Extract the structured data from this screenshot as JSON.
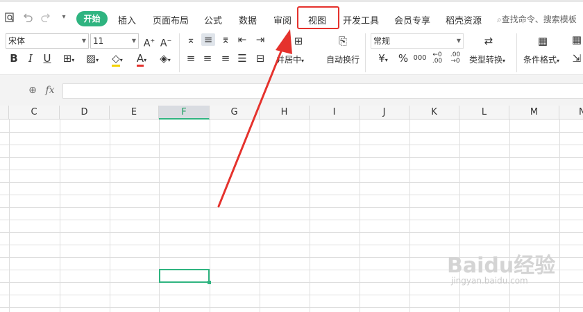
{
  "menubar": {
    "start_label": "开始",
    "tabs": [
      "插入",
      "页面布局",
      "公式",
      "数据",
      "审阅",
      "视图",
      "开发工具",
      "会员专享",
      "稻壳资源"
    ],
    "search_placeholder": "查找命令、搜索模板"
  },
  "toolbar": {
    "font_name": "宋体",
    "font_size": "11",
    "merge_label": "并居中",
    "wrap_label": "自动换行",
    "number_format": "常规",
    "currency_symbol": "¥",
    "percent_symbol": "%",
    "thousands_symbol": "000",
    "type_convert_label": "类型转换",
    "cond_format_label": "条件格式"
  },
  "formula_bar": {
    "fx_label": "fx"
  },
  "sheet": {
    "columns": [
      "C",
      "D",
      "E",
      "F",
      "G",
      "H",
      "I",
      "J",
      "K",
      "L",
      "M",
      "N"
    ],
    "selected_column": "F"
  },
  "annotation": {
    "highlight_color": "#e5322d"
  },
  "watermark": {
    "main": "Baidu经验",
    "sub": "jingyan.baidu.com"
  }
}
